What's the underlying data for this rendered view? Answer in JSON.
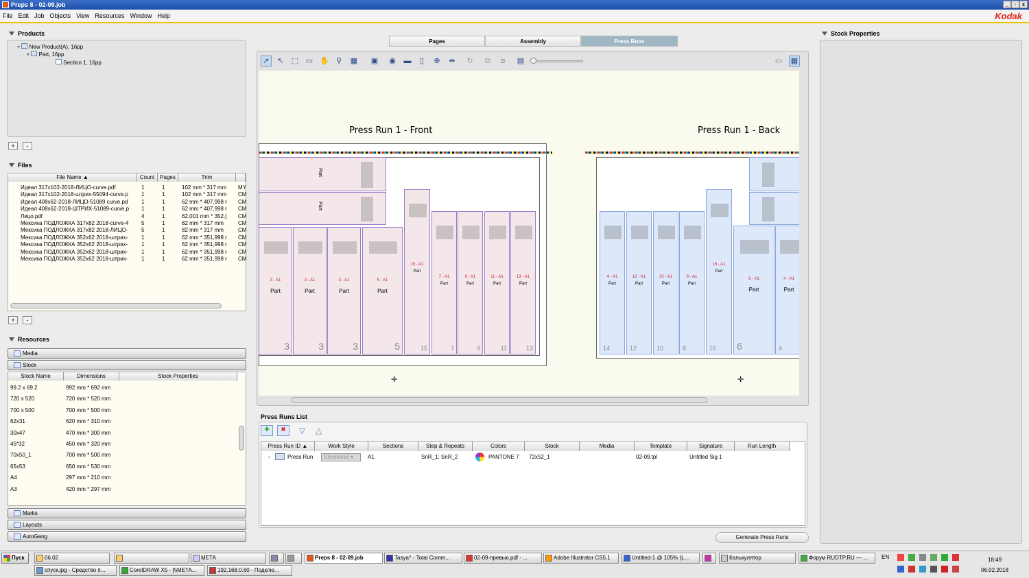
{
  "window": {
    "title": "Preps 8 - 02-09.job",
    "minimize": "_",
    "restore": "▫",
    "close": "x"
  },
  "menu": [
    "File",
    "Edit",
    "Job",
    "Objects",
    "View",
    "Resources",
    "Window",
    "Help"
  ],
  "brand": "Kodak",
  "products": {
    "header": "Products",
    "tree": [
      "New Product(A), 16pp",
      "Part, 16pp",
      "Section 1, 16pp"
    ],
    "add": "+",
    "remove": "-"
  },
  "files": {
    "header": "Files",
    "columns": [
      "File Name",
      "Count",
      "Pages",
      "Trim",
      ""
    ],
    "rows": [
      [
        "Идеал 317х102-2018-ЛИЦО-curve.pdf",
        "1",
        "1",
        "102 mm * 317 mm",
        "MY"
      ],
      [
        "Идеал 317х102-2018-штрих-55094-curve.p",
        "1",
        "1",
        "102 mm * 317 mm",
        "CM"
      ],
      [
        "Идеал 408х62-2018-ЛИЦО-51089 curve.pd",
        "1",
        "1",
        "62 mm * 407,998 r",
        "CM"
      ],
      [
        "Идеал 408х62-2018-ШТРИХ-51089-curve.p",
        "1",
        "1",
        "62 mm * 407,998 r",
        "CM"
      ],
      [
        "Лицо.pdf",
        "4",
        "1",
        "62,001 mm * 352,(",
        "CM"
      ],
      [
        "Мексика ПОДЛОЖКА 317х82 2018-curve-4",
        "5",
        "1",
        "82 mm * 317 mm",
        "CM"
      ],
      [
        "Мексика ПОДЛОЖКА 317х82 2018-ЛИЦО-",
        "5",
        "1",
        "82 mm * 317 mm",
        "CM"
      ],
      [
        "Мексика ПОДЛОЖКА 352х62 2018-штрих-",
        "1",
        "1",
        "62 mm * 351,998 r",
        "CM"
      ],
      [
        "Мексика ПОДЛОЖКА 352х62 2018-штрих-",
        "1",
        "1",
        "62 mm * 351,998 r",
        "CM"
      ],
      [
        "Мексика ПОДЛОЖКА 352х62 2018-штрих-",
        "1",
        "1",
        "62 mm * 351,998 r",
        "CM"
      ],
      [
        "Мексика ПОДЛОЖКА 352х62 2018-штрих-",
        "1",
        "1",
        "62 mm * 351,998 r",
        "CM"
      ]
    ],
    "add": "+",
    "remove": "-"
  },
  "resources": {
    "header": "Resources",
    "media": "Media",
    "stock": "Stock",
    "stock_columns": [
      "Stock Name",
      "Dimensions",
      "Stock Properties"
    ],
    "stock_rows": [
      [
        "99.2 x 69.2",
        "992 mm * 692 mm"
      ],
      [
        "720 x 520",
        "720 mm * 520 mm"
      ],
      [
        "700 x 500",
        "700 mm * 500 mm"
      ],
      [
        "62x31",
        "620 mm * 310 mm"
      ],
      [
        "30x47",
        "470 mm * 300 mm"
      ],
      [
        "45*32",
        "450 mm * 320 mm"
      ],
      [
        "70x50_1",
        "700 mm * 500 mm"
      ],
      [
        "65x53",
        "650 mm * 530 mm"
      ],
      [
        "A4",
        "297 mm * 210 mm"
      ],
      [
        "A3",
        "420 mm * 297 mm"
      ]
    ],
    "marks": "Marks",
    "layouts": "Layouts",
    "autogang": "AutoGang"
  },
  "tabs": [
    "Pages",
    "Assembly",
    "Press Runs"
  ],
  "canvas": {
    "front_title": "Press Run 1  -  Front",
    "back_title": "Press Run 1  -  Back",
    "front_sigs": [
      {
        "label": "3 - A1",
        "part": "Part",
        "num": "3"
      },
      {
        "label": "3 - A1",
        "part": "Part",
        "num": "3"
      },
      {
        "label": "3 - A1",
        "part": "Part",
        "num": "3"
      },
      {
        "label": "5 - A1",
        "part": "Part",
        "num": "5"
      },
      {
        "label": "15 - A1",
        "part": "Part",
        "num": "15"
      },
      {
        "label": "7 - A1",
        "part": "Part",
        "num": "7"
      },
      {
        "label": "9 - A1",
        "part": "Part",
        "num": "9"
      },
      {
        "label": "11 - A1",
        "part": "Part",
        "num": "11"
      },
      {
        "label": "13 - A1",
        "part": "Part",
        "num": "13"
      }
    ],
    "front_top": [
      {
        "label": "1 - A1",
        "part": "Part"
      },
      {
        "label": "1 - A1",
        "part": "Part"
      }
    ],
    "back_sigs": [
      {
        "label": "4 - A1",
        "part": "Part",
        "num": "14"
      },
      {
        "label": "12 - A1",
        "part": "Part",
        "num": "12"
      },
      {
        "label": "10 - A1",
        "part": "Part",
        "num": "10"
      },
      {
        "label": "8 - A1",
        "part": "Part",
        "num": "8"
      },
      {
        "label": "16 - A1",
        "part": "Part",
        "num": "16"
      },
      {
        "label": "6 - A1",
        "part": "Part",
        "num": "6"
      },
      {
        "label": "4 - A1",
        "part": "Part",
        "num": "4"
      }
    ]
  },
  "press_runs": {
    "header": "Press Runs List",
    "columns": [
      "Press Run ID",
      "Work Style",
      "Sections",
      "Step & Repeats",
      "Colors",
      "Stock",
      "Media",
      "Template",
      "Signature",
      "Run Length"
    ],
    "row": {
      "id": "Press Run",
      "work_style": "Sheetwise",
      "sections": "A1",
      "step_repeats": "SnR_1; SnR_2",
      "colors": "PANTONE 7",
      "stock": "72x52_1",
      "media": "",
      "template": "02-09.tpl",
      "signature": "Untitled Sig 1",
      "run_length": ""
    },
    "generate_button": "Generate Press Runs"
  },
  "stock_properties": {
    "header": "Stock Properties"
  },
  "taskbar": {
    "start": "Пуск",
    "row1": [
      "06.02",
      "",
      "МЕТА",
      "",
      "",
      "Preps 8 - 02-09.job",
      "Tasya^ - Total Comm...",
      "02-09-превью.pdf - ...",
      "Adobe Illustrator CS5.1",
      "Untitled-1 @ 105% (L...",
      "",
      "Калькулятор",
      "Форум RUDTP.RU — ..."
    ],
    "row2": [
      "спуск.jpg - Средство п...",
      "CorelDRAW X5 - [\\\\META...",
      "192.168.0.60 - Подклю..."
    ],
    "lang": "EN",
    "time": "18:49",
    "date": "06.02.2018"
  }
}
